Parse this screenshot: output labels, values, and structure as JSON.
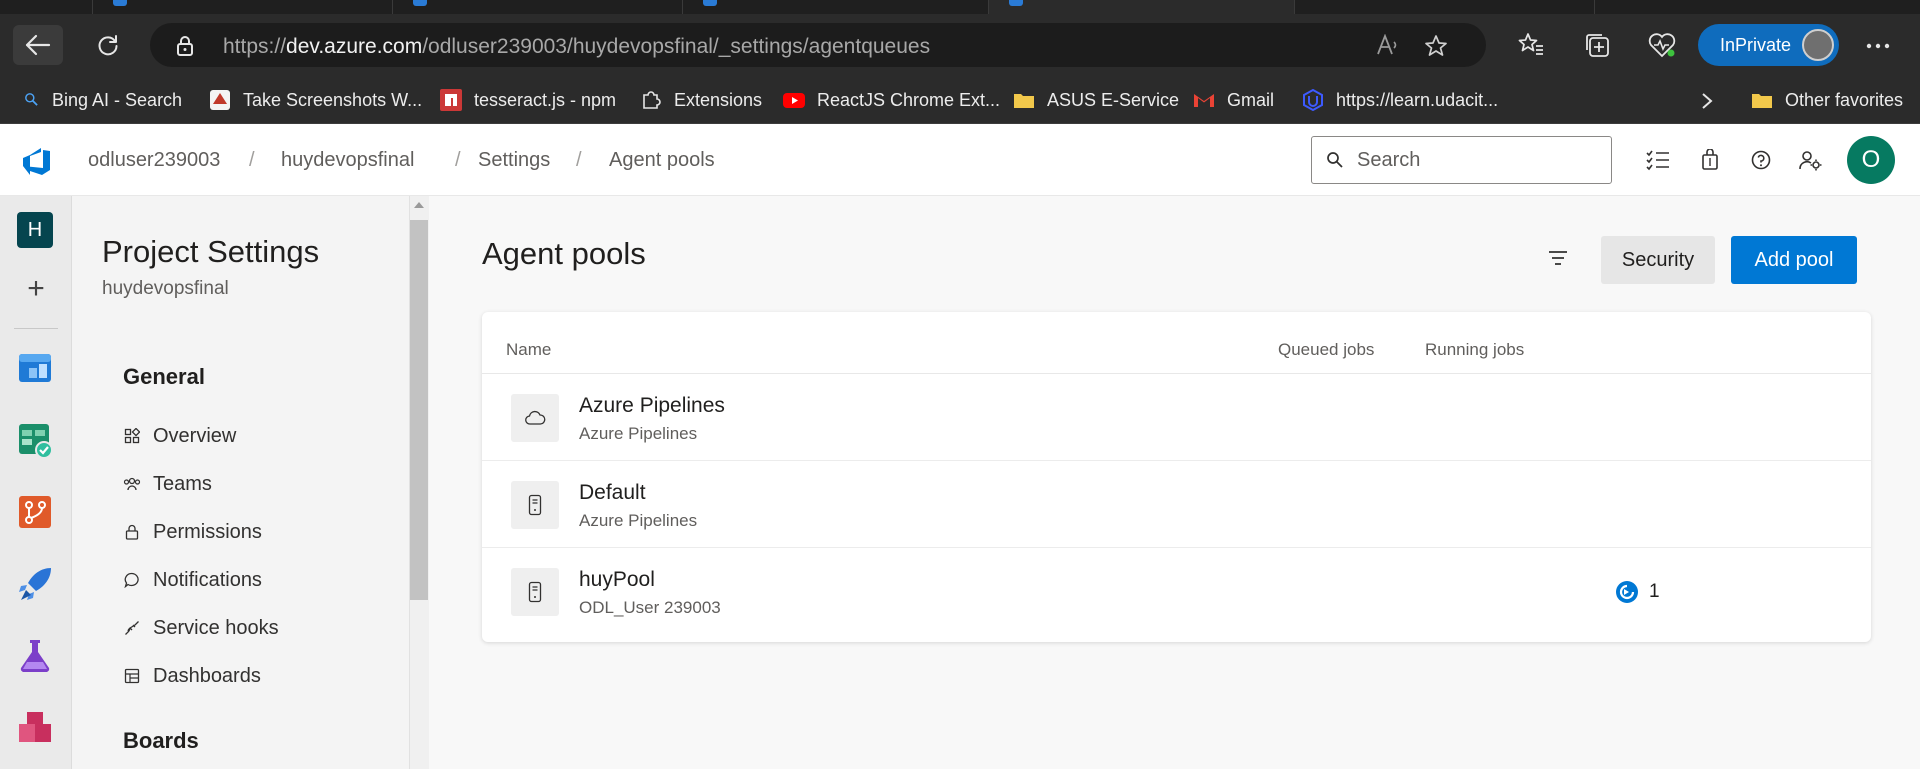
{
  "browser": {
    "address_bar": {
      "url_prefix": "https://",
      "url_host": "dev.azure.com",
      "url_path": "/odluser239003/huydevopsfinal/_settings/agentqueues"
    },
    "inprivate_label": "InPrivate",
    "favorites": [
      {
        "label": "Bing AI - Search",
        "icon": "search-icon"
      },
      {
        "label": "Take Screenshots W...",
        "icon": "screenshot-app-icon"
      },
      {
        "label": "tesseract.js - npm",
        "icon": "npm-icon"
      },
      {
        "label": "Extensions",
        "icon": "puzzle-icon"
      },
      {
        "label": "ReactJS Chrome Ext...",
        "icon": "youtube-icon"
      },
      {
        "label": "ASUS E-Service",
        "icon": "folder-icon"
      },
      {
        "label": "Gmail",
        "icon": "gmail-icon"
      },
      {
        "label": "https://learn.udacit...",
        "icon": "udacity-icon"
      }
    ],
    "other_favorites_label": "Other favorites"
  },
  "header": {
    "breadcrumb": [
      "odluser239003",
      "huydevopsfinal",
      "Settings",
      "Agent pools"
    ],
    "search_placeholder": "Search",
    "user_initial": "O"
  },
  "rail": {
    "project_initial": "H"
  },
  "settings_nav": {
    "title": "Project Settings",
    "subtitle": "huydevopsfinal",
    "groups": [
      {
        "label": "General",
        "items": [
          {
            "label": "Overview",
            "icon": "overview-icon"
          },
          {
            "label": "Teams",
            "icon": "teams-icon"
          },
          {
            "label": "Permissions",
            "icon": "lock-icon"
          },
          {
            "label": "Notifications",
            "icon": "chat-bubble-icon"
          },
          {
            "label": "Service hooks",
            "icon": "plug-icon"
          },
          {
            "label": "Dashboards",
            "icon": "dashboard-icon"
          }
        ]
      },
      {
        "label": "Boards",
        "items": []
      }
    ]
  },
  "main": {
    "title": "Agent pools",
    "security_label": "Security",
    "add_pool_label": "Add pool",
    "columns": [
      "Name",
      "Queued jobs",
      "Running jobs"
    ],
    "pools": [
      {
        "name": "Azure Pipelines",
        "owner": "Azure Pipelines",
        "icon": "cloud-icon",
        "queued": "",
        "running": ""
      },
      {
        "name": "Default",
        "owner": "Azure Pipelines",
        "icon": "agent-device-icon",
        "queued": "",
        "running": ""
      },
      {
        "name": "huyPool",
        "owner": "ODL_User 239003",
        "icon": "agent-device-icon",
        "queued": "",
        "running": "1"
      }
    ]
  },
  "colors": {
    "accent": "#0078d4",
    "avatar_green": "#067a61",
    "project_tile": "#05454f",
    "inprivate": "#0f6cbd"
  }
}
